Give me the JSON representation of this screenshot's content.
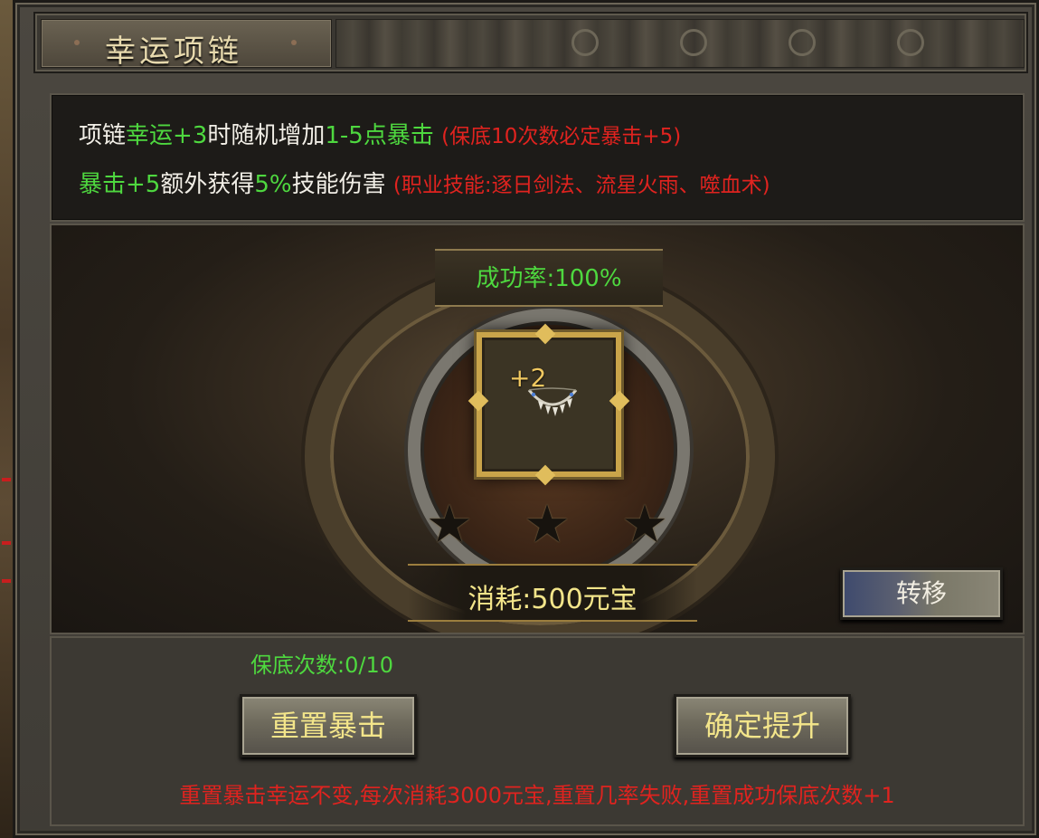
{
  "window": {
    "title": "幸运项链"
  },
  "description": {
    "line1": {
      "t1": "项链",
      "t2": "幸运+3",
      "t3": "时随机增加",
      "t4": "1-5点暴击",
      "t5": "(保底10次数必定暴击+5)"
    },
    "line2": {
      "t1": "暴击+5",
      "t2": "额外获得",
      "t3": "5%",
      "t4": "技能伤害",
      "t5": "(职业技能:逐日剑法、流星火雨、噬血术)"
    }
  },
  "upgrade": {
    "success_rate": "成功率:100%",
    "item_level": "+2",
    "item_icon": "necklace-icon",
    "stars": [
      {
        "name": "star-1",
        "filled": false
      },
      {
        "name": "star-2",
        "filled": false
      },
      {
        "name": "star-3",
        "filled": false
      }
    ],
    "cost": "消耗:500元宝",
    "transfer_label": "转移"
  },
  "bottom": {
    "guarantee": "保底次数:0/10",
    "reset_label": "重置暴击",
    "confirm_label": "确定提升",
    "note": "重置暴击幸运不变,每次消耗3000元宝,重置几率失败,重置成功保底次数+1"
  },
  "colors": {
    "green": "#4ed83f",
    "red": "#e0231f",
    "gold": "#f3e58a",
    "frame_gold": "#c9a44a"
  }
}
